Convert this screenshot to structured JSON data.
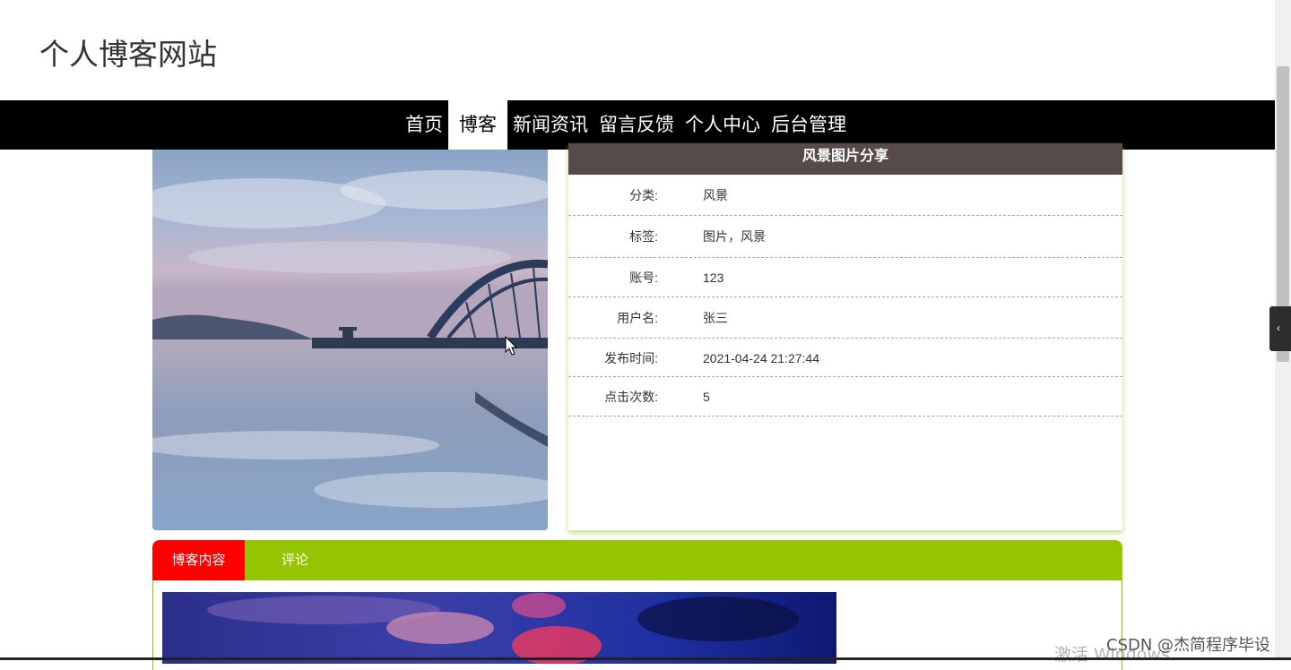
{
  "site": {
    "title": "个人博客网站"
  },
  "nav": {
    "items": [
      {
        "label": "首页",
        "active": false
      },
      {
        "label": "博客",
        "active": true
      },
      {
        "label": "新闻资讯",
        "active": false
      },
      {
        "label": "留言反馈",
        "active": false
      },
      {
        "label": "个人中心",
        "active": false
      },
      {
        "label": "后台管理",
        "active": false
      }
    ]
  },
  "post": {
    "title": "风景图片分享",
    "fields": [
      {
        "label": "分类:",
        "value": "风景"
      },
      {
        "label": "标签:",
        "value": "图片，风景"
      },
      {
        "label": "账号:",
        "value": "123"
      },
      {
        "label": "用户名:",
        "value": "张三"
      },
      {
        "label": "发布时间:",
        "value": "2021-04-24 21:27:44"
      },
      {
        "label": "点击次数:",
        "value": "5"
      }
    ]
  },
  "tabs": [
    {
      "label": "博客内容",
      "active": true
    },
    {
      "label": "评论",
      "active": false
    }
  ],
  "watermark": {
    "activate_windows": "激活 Windows",
    "csdn": "CSDN @杰简程序毕设"
  },
  "colors": {
    "nav_bg": "#000000",
    "card_header": "#564a4a",
    "tab_green": "#95c500",
    "tab_active": "#ff0000"
  },
  "icons": {
    "side_toggle": "chevron-left-icon"
  }
}
